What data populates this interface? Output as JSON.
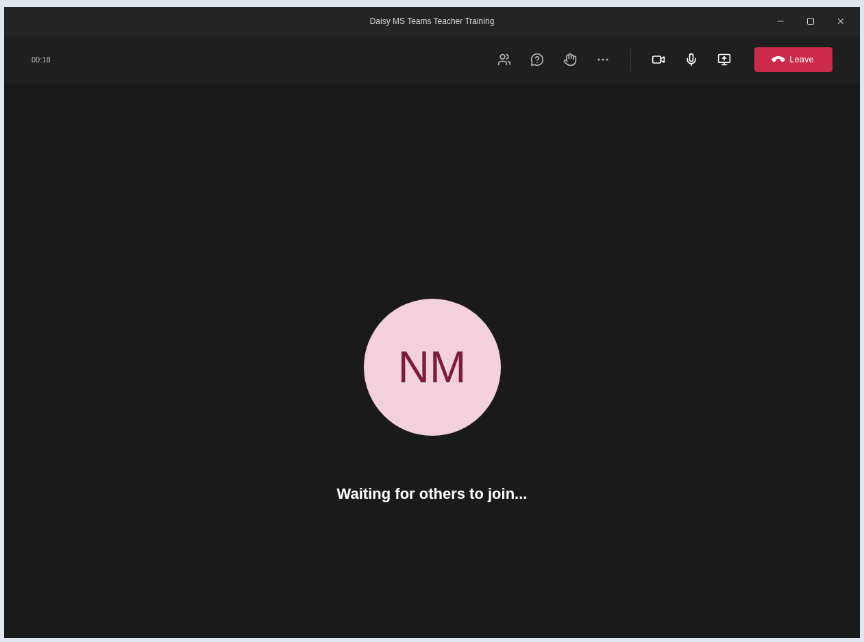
{
  "window": {
    "title": "Daisy MS Teams Teacher Training"
  },
  "toolbar": {
    "timer": "00:18",
    "leave_label": "Leave"
  },
  "avatar": {
    "initials": "NM"
  },
  "status": "Waiting for others to join..."
}
